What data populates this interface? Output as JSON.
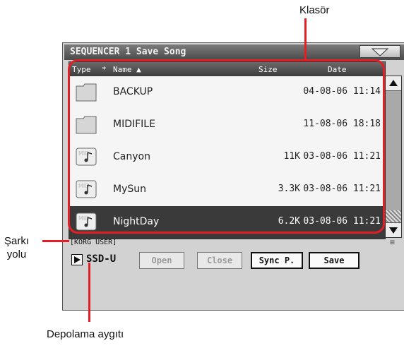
{
  "callouts": {
    "folder": "Klasör",
    "song_path_line1": "Şarkı",
    "song_path_line2": "yolu",
    "storage_device": "Depolama aygıtı"
  },
  "window": {
    "title": "SEQUENCER 1  Save Song",
    "menu_icon": "triangle-down-icon"
  },
  "columns": {
    "type": "Type",
    "star": "*",
    "name": "Name",
    "size": "Size",
    "date": "Date"
  },
  "files": [
    {
      "type": "folder",
      "name": "BACKUP",
      "size": "",
      "date": "04-08-06 11:14"
    },
    {
      "type": "folder",
      "name": "MIDIFILE",
      "size": "",
      "date": "11-08-06 18:18"
    },
    {
      "type": "midi",
      "name": "Canyon",
      "size": "11K",
      "date": "03-08-06 11:21"
    },
    {
      "type": "midi",
      "name": "MySun",
      "size": "3.3K",
      "date": "03-08-06 11:21"
    },
    {
      "type": "midi",
      "name": "NightDay",
      "size": "6.2K",
      "date": "03-08-06 11:21",
      "selected": true
    }
  ],
  "path": "[KORG USER]",
  "drive": "SSD-U",
  "buttons": {
    "open": "Open",
    "close": "Close",
    "sync": "Sync P.",
    "save": "Save"
  },
  "colors": {
    "callout_red": "#e51e25",
    "selected_row": "#3a3a3a"
  }
}
